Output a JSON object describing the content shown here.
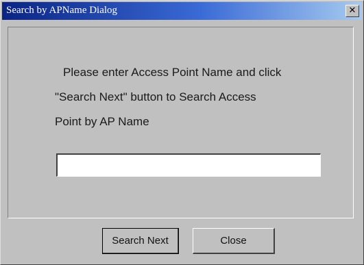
{
  "window": {
    "title": "Search by APName Dialog",
    "close_glyph": "✕"
  },
  "message": {
    "line1": "Please enter Access Point Name and click",
    "line2": "\"Search Next\" button to Search Access",
    "line3": "Point by AP Name"
  },
  "input": {
    "value": "",
    "placeholder": ""
  },
  "buttons": {
    "search_next": "Search Next",
    "close": "Close"
  },
  "colors": {
    "title_start": "#0a2484",
    "title_end": "#a6caf0",
    "dialog_bg": "#c0c0c0"
  }
}
